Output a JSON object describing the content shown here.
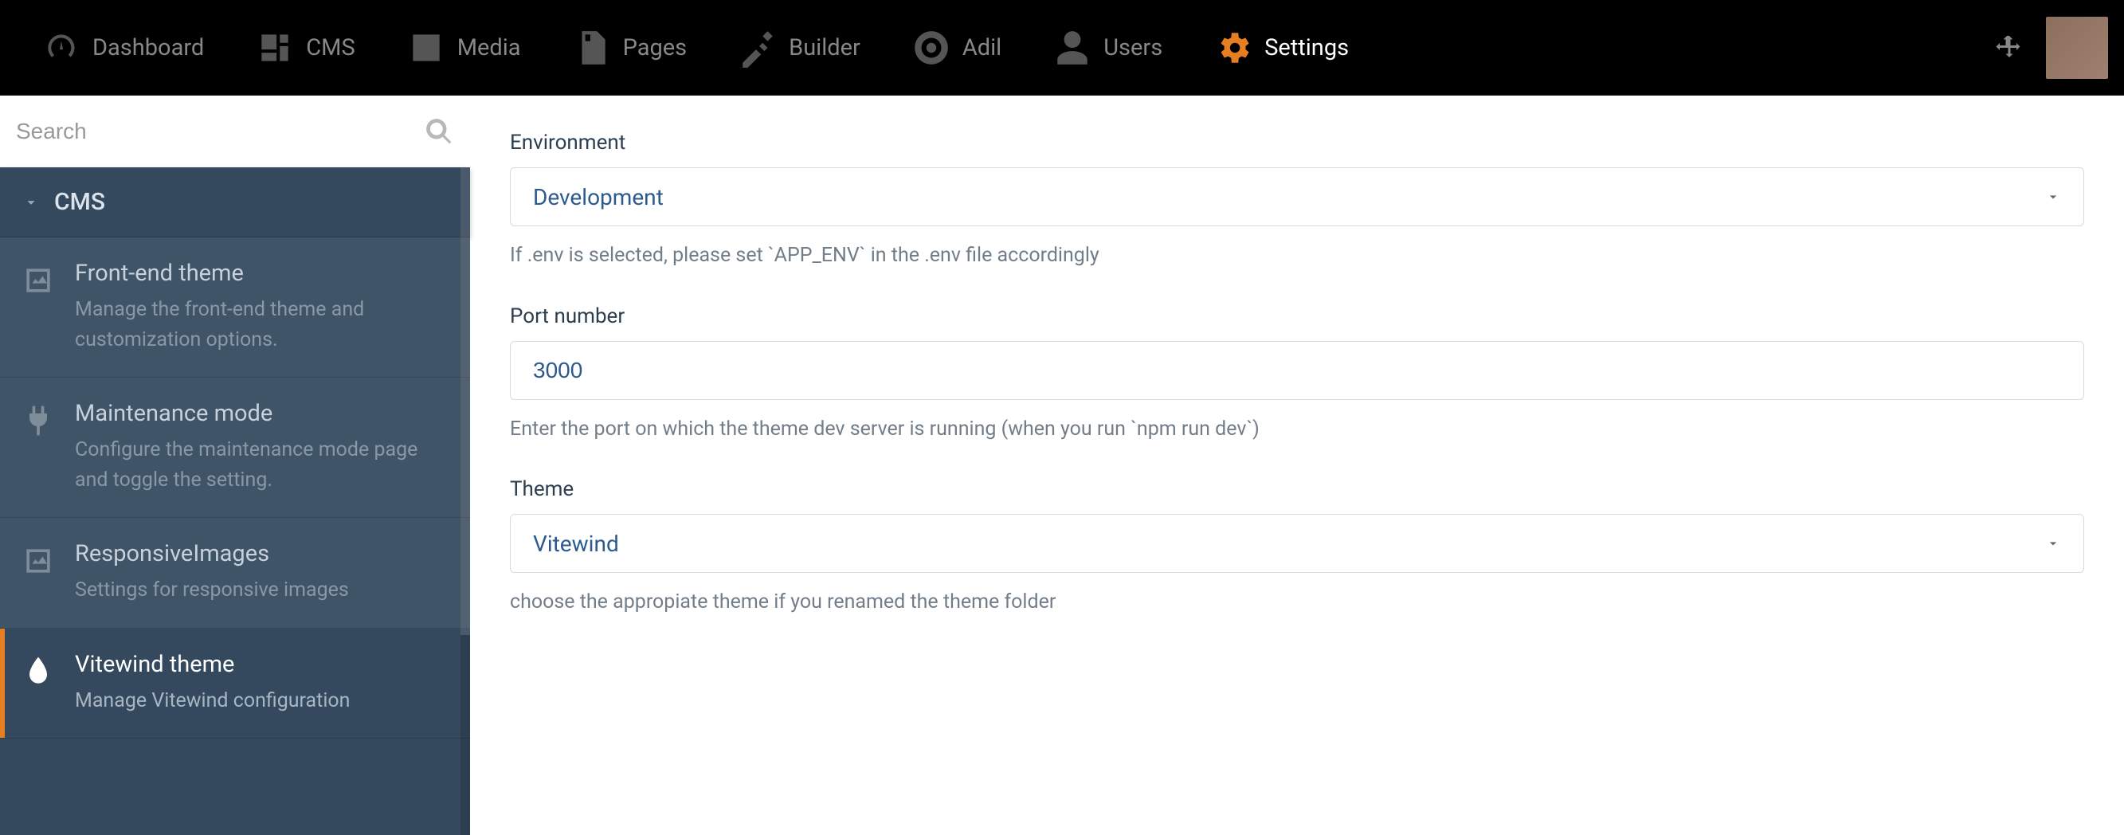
{
  "nav": {
    "items": [
      {
        "label": "Dashboard",
        "icon": "gauge"
      },
      {
        "label": "CMS",
        "icon": "cms"
      },
      {
        "label": "Media",
        "icon": "image"
      },
      {
        "label": "Pages",
        "icon": "page"
      },
      {
        "label": "Builder",
        "icon": "wrench"
      },
      {
        "label": "Adil",
        "icon": "life-ring"
      },
      {
        "label": "Users",
        "icon": "user"
      },
      {
        "label": "Settings",
        "icon": "gears",
        "active": true
      }
    ]
  },
  "search": {
    "placeholder": "Search"
  },
  "sidebar": {
    "section": "CMS",
    "items": [
      {
        "title": "Front-end theme",
        "desc": "Manage the front-end theme and customization options."
      },
      {
        "title": "Maintenance mode",
        "desc": "Configure the maintenance mode page and toggle the setting."
      },
      {
        "title": "ResponsiveImages",
        "desc": "Settings for responsive images"
      },
      {
        "title": "Vitewind theme",
        "desc": "Manage Vitewind configuration"
      }
    ]
  },
  "form": {
    "environment": {
      "label": "Environment",
      "value": "Development",
      "help": "If .env is selected, please set `APP_ENV` in the .env file accordingly"
    },
    "port": {
      "label": "Port number",
      "value": "3000",
      "help": "Enter the port on which the theme dev server is running (when you run `npm run dev`)"
    },
    "theme": {
      "label": "Theme",
      "value": "Vitewind",
      "help": "choose the appropiate theme if you renamed the theme folder"
    }
  }
}
